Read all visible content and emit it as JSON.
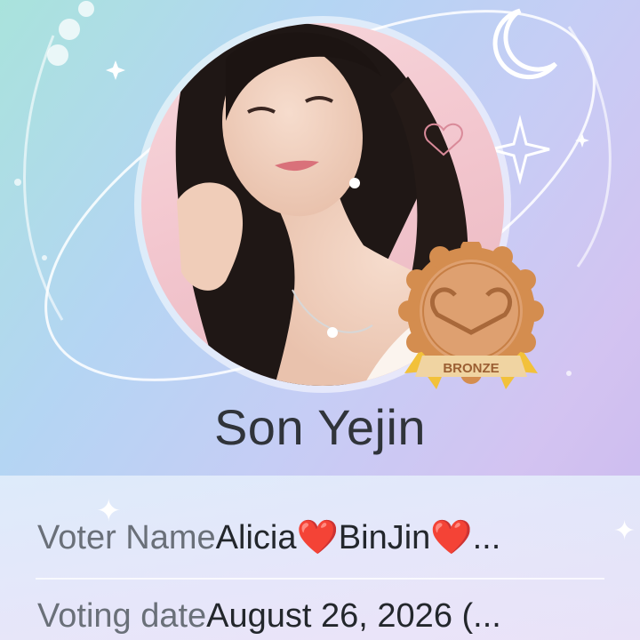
{
  "idol": {
    "name": "Son Yejin",
    "badge_text": "BRONZE"
  },
  "voter": {
    "name_label": "Voter Name",
    "name_value": "Alicia❤️BinJin❤️..."
  },
  "voting": {
    "date_label": "Voting date",
    "date_value": "August 26, 2026 (..."
  },
  "icons": [
    "moon-icon",
    "star-icon",
    "heart-icon",
    "sparkle-icon",
    "bronze-medal-icon"
  ],
  "colors": {
    "background_start": "#a9e3dc",
    "background_end": "#c9b8ee",
    "medal_bronze": "#d9955a",
    "medal_ribbon": "#f2c13a",
    "name_text": "#30343a"
  }
}
